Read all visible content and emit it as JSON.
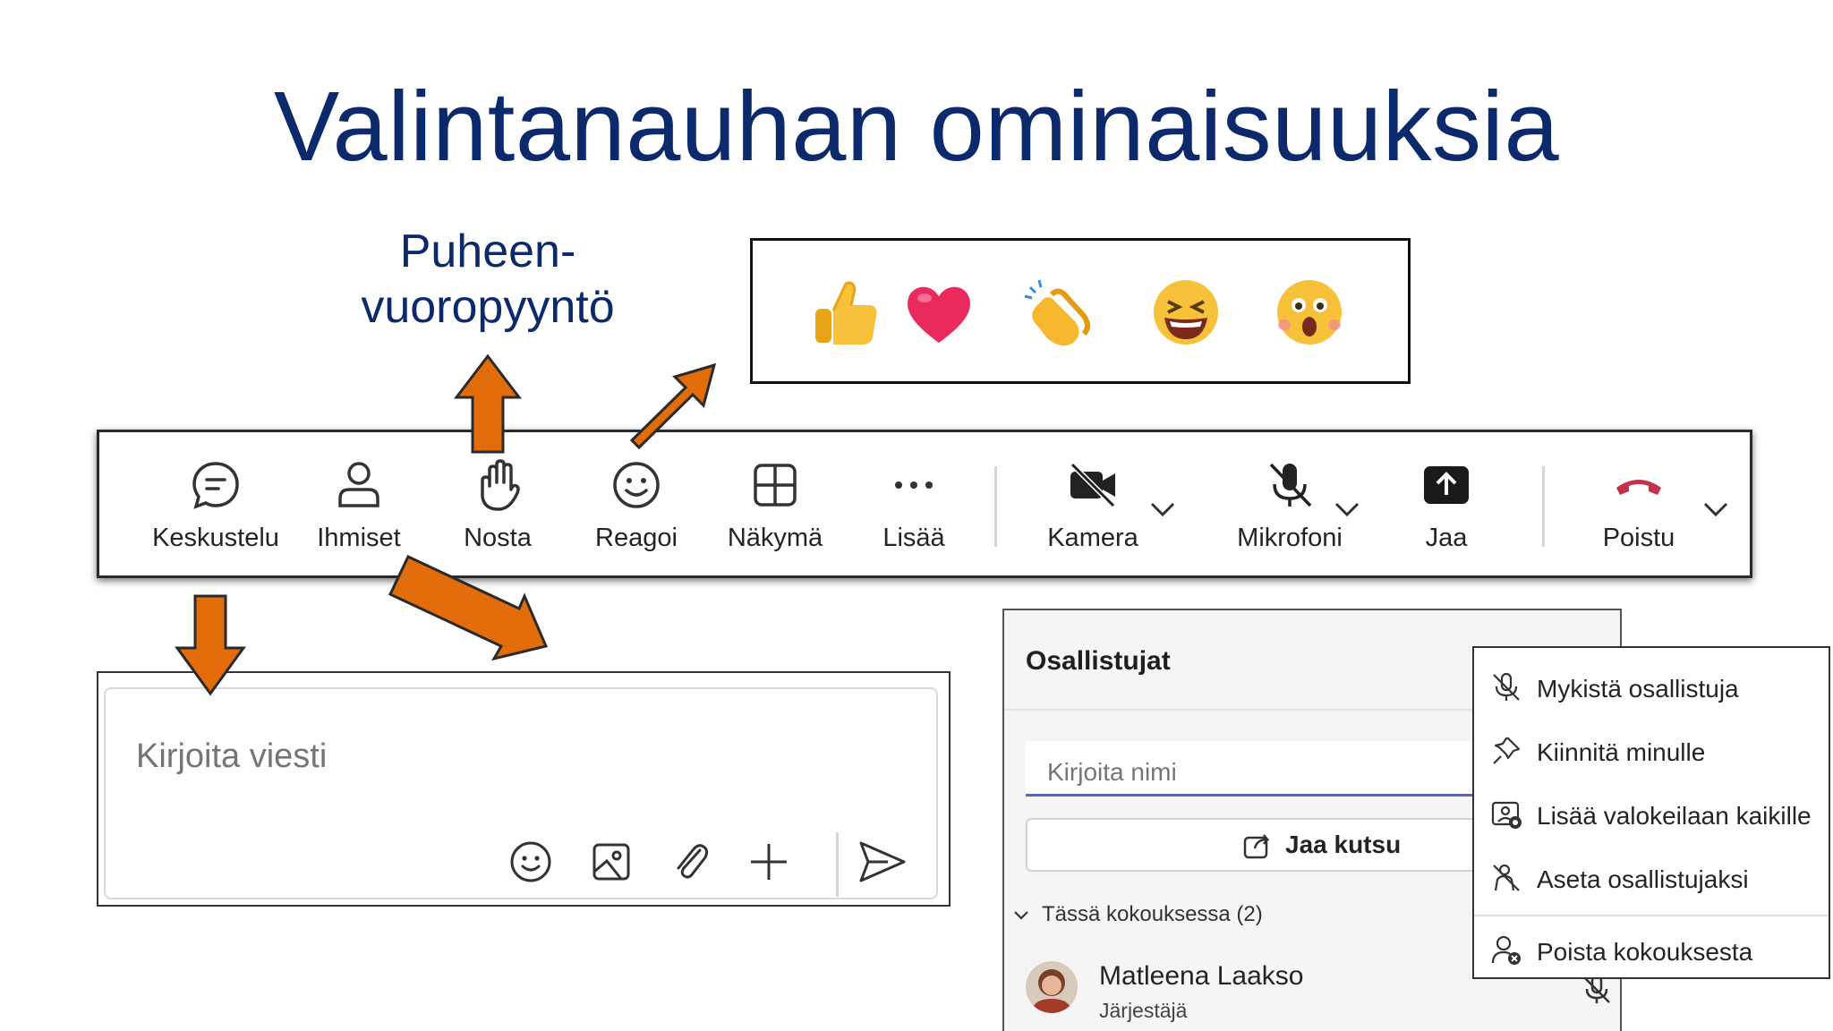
{
  "slide": {
    "title": "Valintanauhan ominaisuuksia",
    "callout_line1": "Puheen-",
    "callout_line2": "vuoropyyntö"
  },
  "reactions": {
    "items": [
      {
        "name": "like-emoji"
      },
      {
        "name": "heart-emoji"
      },
      {
        "name": "clap-emoji"
      },
      {
        "name": "laugh-emoji"
      },
      {
        "name": "surprised-emoji"
      }
    ]
  },
  "toolbar": {
    "chat": "Keskustelu",
    "people": "Ihmiset",
    "raise": "Nosta",
    "react": "Reagoi",
    "view": "Näkymä",
    "more": "Lisää",
    "camera": "Kamera",
    "mic": "Mikrofoni",
    "share": "Jaa",
    "leave": "Poistu"
  },
  "compose": {
    "placeholder": "Kirjoita viesti"
  },
  "participants": {
    "title": "Osallistujat",
    "search_placeholder": "Kirjoita nimi",
    "invite_label": "Jaa kutsu",
    "section_label": "Tässä kokouksessa (2)",
    "person": {
      "name": "Matleena Laakso",
      "role": "Järjestäjä"
    }
  },
  "menu": {
    "items": [
      {
        "label": "Mykistä osallistuja",
        "icon": "mic-off-icon"
      },
      {
        "label": "Kiinnitä minulle",
        "icon": "pin-icon"
      },
      {
        "label": "Lisää valokeilaan kaikille",
        "icon": "spotlight-icon"
      },
      {
        "label": "Aseta osallistujaksi",
        "icon": "attendee-icon"
      },
      {
        "label": "Poista kokouksesta",
        "icon": "remove-person-icon"
      }
    ]
  },
  "colors": {
    "title": "#0c2a6b",
    "arrow": "#e36c0a",
    "accent": "#5b5fc7",
    "leave": "#c4314b"
  }
}
